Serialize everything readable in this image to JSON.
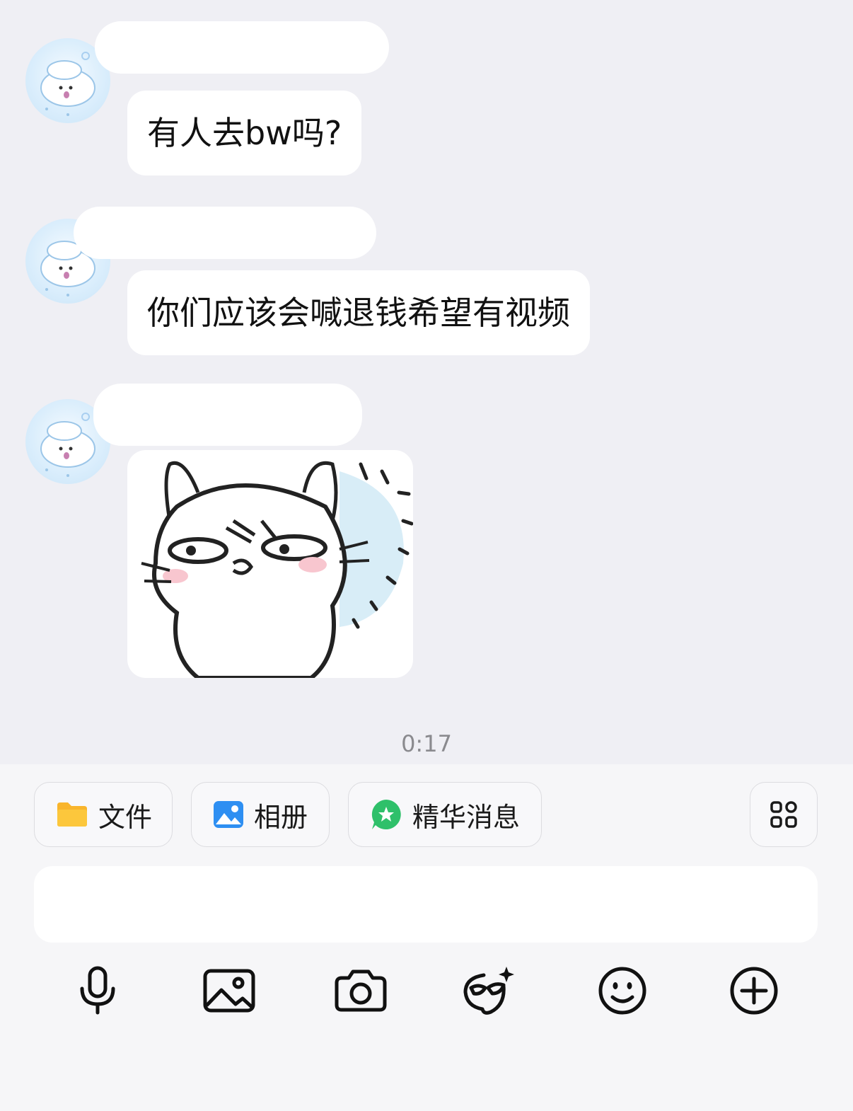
{
  "messages": [
    {
      "type": "text",
      "text": "有人去bw吗?"
    },
    {
      "type": "text",
      "text": "你们应该会喊退钱希望有视频"
    },
    {
      "type": "sticker",
      "icon": "cat-sticker"
    }
  ],
  "timestamp": "0:17",
  "quick_actions": [
    {
      "label": "文件",
      "icon": "folder-icon",
      "color": "#f9b52b"
    },
    {
      "label": "相册",
      "icon": "photo-album-icon",
      "color": "#2e8ff2"
    },
    {
      "label": "精华消息",
      "icon": "featured-message-icon",
      "color": "#2fc06a"
    }
  ],
  "message_input": {
    "value": ""
  },
  "toolbar": [
    "microphone-icon",
    "image-icon",
    "camera-icon",
    "avatar-effect-icon",
    "emoji-icon",
    "add-icon"
  ]
}
